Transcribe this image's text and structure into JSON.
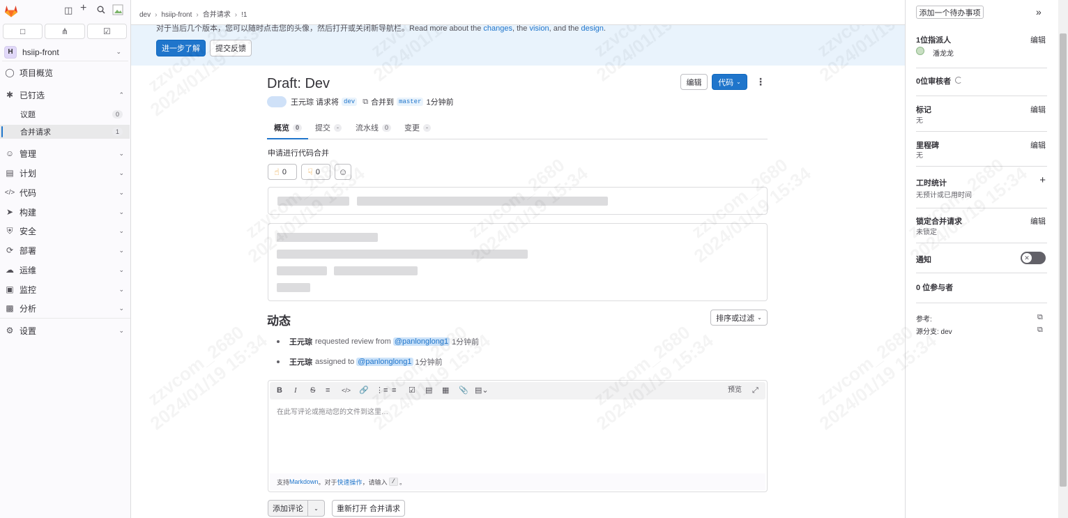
{
  "sidebar": {
    "project_initial": "H",
    "project_name": "hsiip-front",
    "items": [
      {
        "label": "项目概览",
        "icon": "project-icon"
      },
      {
        "label": "已钉选",
        "icon": "pin-icon"
      },
      {
        "label": "管理",
        "icon": "users-icon"
      },
      {
        "label": "计划",
        "icon": "calendar-icon"
      },
      {
        "label": "代码",
        "icon": "code-icon"
      },
      {
        "label": "构建",
        "icon": "rocket-icon"
      },
      {
        "label": "安全",
        "icon": "shield-icon"
      },
      {
        "label": "部署",
        "icon": "deploy-icon"
      },
      {
        "label": "运维",
        "icon": "cloud-icon"
      },
      {
        "label": "监控",
        "icon": "monitor-icon"
      },
      {
        "label": "分析",
        "icon": "chart-icon"
      },
      {
        "label": "设置",
        "icon": "gear-icon"
      }
    ],
    "pinned": [
      {
        "label": "议题",
        "count": "0"
      },
      {
        "label": "合并请求",
        "count": "1"
      }
    ]
  },
  "breadcrumb": [
    "dev",
    "hsiip-front",
    "合并请求",
    "!1"
  ],
  "banner": {
    "text_prefix": "对于当后几个版本，您可以随时点击您的头像，然后打开或关闭新导航栏。Read more about the ",
    "link1": "changes",
    "mid1": ", the ",
    "link2": "vision",
    "mid2": ", and the ",
    "link3": "design",
    "suffix": ".",
    "learn_more": "进一步了解",
    "feedback": "提交反馈"
  },
  "mr": {
    "title": "Draft: Dev",
    "author": "王元琮",
    "request_text": "请求将",
    "source_branch": "dev",
    "merge_into": "合并到",
    "target_branch": "master",
    "time": "1分钟前",
    "edit_label": "编辑",
    "code_label": "代码",
    "description": "申请进行代码合并",
    "thumbs_up": "0",
    "thumbs_down": "0"
  },
  "tabs": [
    {
      "label": "概览",
      "count": "0"
    },
    {
      "label": "提交",
      "count": "-"
    },
    {
      "label": "流水线",
      "count": "0"
    },
    {
      "label": "变更",
      "count": "-"
    }
  ],
  "activity": {
    "title": "动态",
    "sort_label": "排序或过滤",
    "events": [
      {
        "user": "王元琮",
        "action": "requested review from",
        "mention": "@panlonglong1",
        "time": "1分钟前"
      },
      {
        "user": "王元琮",
        "action": "assigned to",
        "mention": "@panlonglong1",
        "time": "1分钟前"
      }
    ]
  },
  "editor": {
    "preview": "预览",
    "placeholder": "在此写评论或拖动您的文件到这里…",
    "footer_prefix": "支持 ",
    "markdown": "Markdown",
    "footer_mid": "。对于 ",
    "quick_actions": "快速操作",
    "footer_suffix": "，请输入",
    "slash": "/",
    "footer_end": "。",
    "add_comment": "添加评论",
    "reopen": "重新打开 合并请求"
  },
  "right_sidebar": {
    "add_todo": "添加一个待办事项",
    "assignee_title": "1位指派人",
    "assignee_name": "潘龙龙",
    "reviewer_title": "0位审核者",
    "labels_title": "标记",
    "labels_value": "无",
    "milestone_title": "里程碑",
    "milestone_value": "无",
    "time_title": "工时统计",
    "time_value": "无预计或已用时间",
    "lock_title": "锁定合并请求",
    "lock_value": "未锁定",
    "notify_title": "通知",
    "participants": "0 位参与者",
    "reference": "参考:",
    "source_branch": "源分支: dev",
    "edit": "编辑"
  },
  "watermark": {
    "line1": "zzvcom_2680",
    "line2": "2024/01/19 15:34"
  },
  "colors": {
    "primary": "#1f75cb",
    "sidebar_bg": "#fbfafd",
    "banner_bg": "#e9f3fc"
  }
}
